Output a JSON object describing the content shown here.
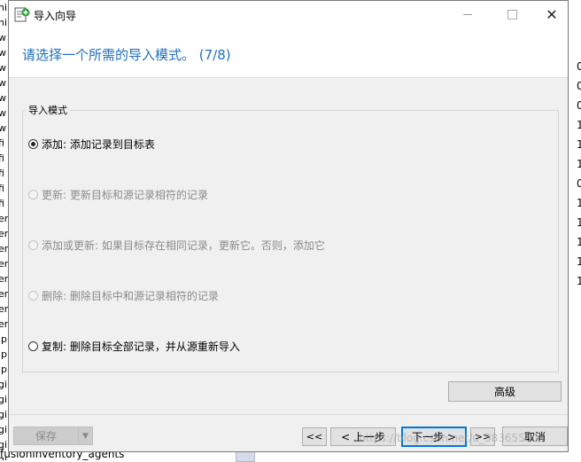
{
  "background": {
    "left_fragments": [
      "ni",
      "ni",
      "w",
      "w",
      "w",
      "w",
      "w",
      "w",
      "w",
      "fi",
      "fi",
      "fi",
      "fi",
      "fi",
      "er",
      "er",
      "er",
      "er",
      "er",
      "er",
      "er",
      "er",
      "ip",
      "ip",
      "ip",
      "gi",
      "gi",
      "gi",
      "gi",
      "gi",
      "gi",
      "gi"
    ],
    "right_numbers": [
      "0",
      "0",
      "0",
      "1",
      "1",
      "1",
      "0",
      "1",
      "1",
      "1",
      "1",
      "1"
    ],
    "bottom_text": "fusioninventory_agents"
  },
  "window": {
    "title": "导入向导",
    "minimize_label": "—",
    "maximize_label": "□",
    "close_label": "✕"
  },
  "header": {
    "title": "请选择一个所需的导入模式。 (7/8)"
  },
  "import_mode": {
    "group_label": "导入模式",
    "options": [
      {
        "label": "添加: 添加记录到目标表",
        "checked": true,
        "enabled": true
      },
      {
        "label": "更新: 更新目标和源记录相符的记录",
        "checked": false,
        "enabled": false
      },
      {
        "label": "添加或更新: 如果目标存在相同记录，更新它。否则，添加它",
        "checked": false,
        "enabled": false
      },
      {
        "label": "删除: 删除目标中和源记录相符的记录",
        "checked": false,
        "enabled": false
      },
      {
        "label": "复制: 删除目标全部记录，并从源重新导入",
        "checked": false,
        "enabled": true
      }
    ]
  },
  "buttons": {
    "advanced": "高级",
    "save": "保存",
    "save_dropdown": "▼",
    "first": "<<",
    "prev": "< 上一步",
    "next": "下一步 >",
    "last": ">>",
    "cancel": "取消"
  },
  "watermark": "https://blog.csdn.net/u_38365580",
  "colors": {
    "header_title": "#1e6fbf",
    "dialog_bg": "#f0f0f0",
    "focus_border": "#0078d7"
  }
}
